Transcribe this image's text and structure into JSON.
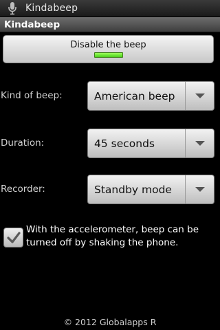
{
  "status_bar": {
    "icon": "microphone-icon",
    "title": "Kindabeep"
  },
  "title_bar": {
    "title": "Kindabeep"
  },
  "beep_button": {
    "label": "Disable the beep",
    "indicator_on": true,
    "indicator_color": "#6fe83a"
  },
  "settings": {
    "kind": {
      "label": "Kind of beep:",
      "value": "American beep"
    },
    "duration": {
      "label": "Duration:",
      "value": "45 seconds"
    },
    "recorder": {
      "label": "Recorder:",
      "value": "Standby mode"
    }
  },
  "accelerometer": {
    "checked": true,
    "text": "With the accelerometer, beep can be turned off by shaking the phone."
  },
  "footer": {
    "text": "© 2012 Globalapps R"
  }
}
